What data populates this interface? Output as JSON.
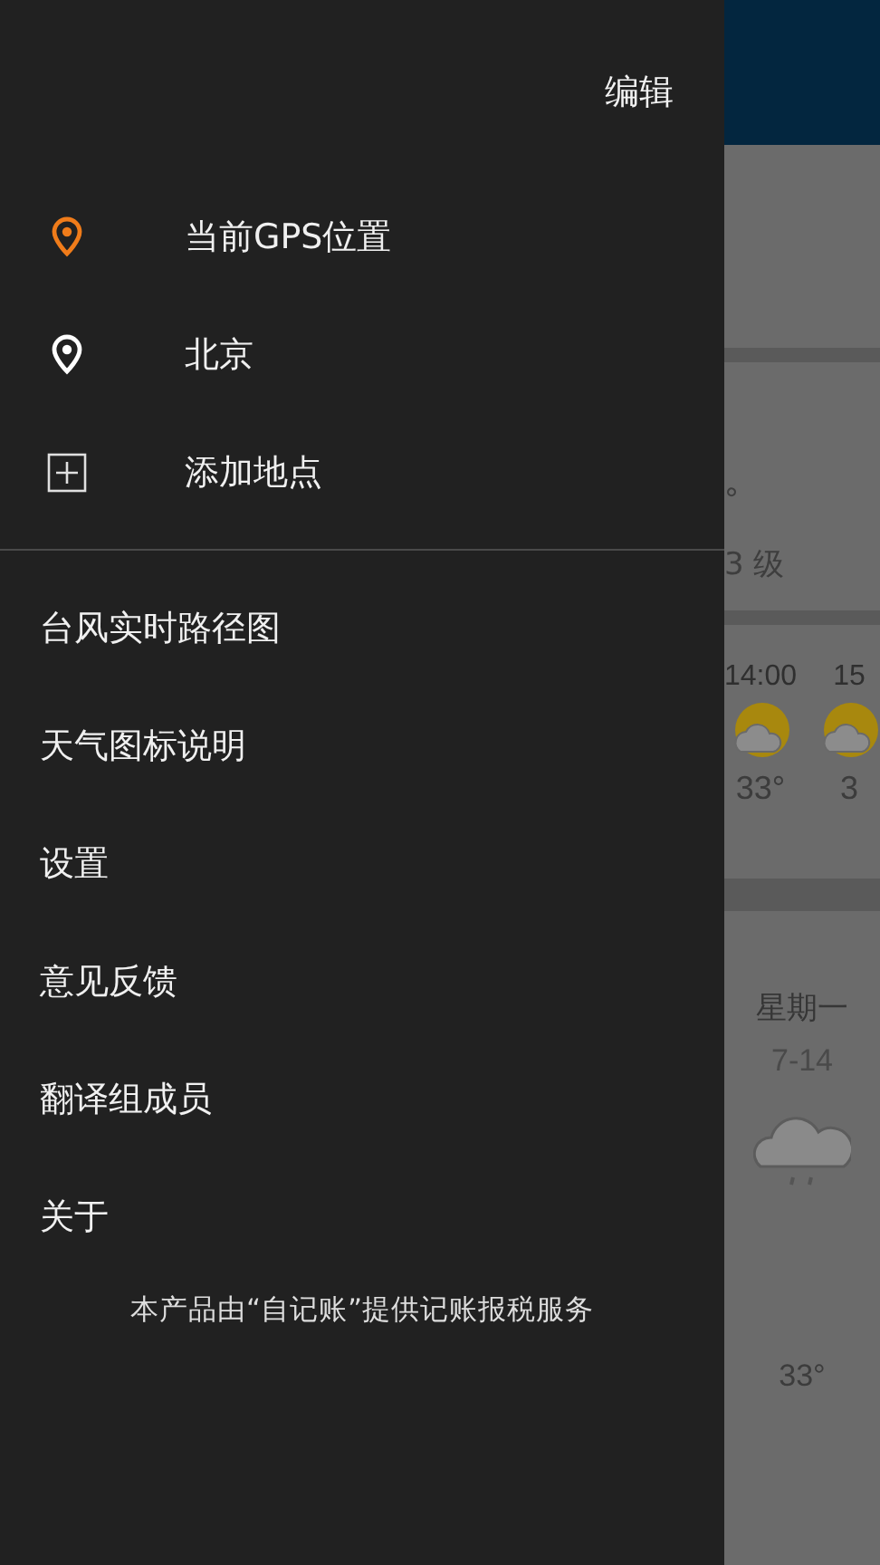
{
  "drawer": {
    "edit_label": "编辑",
    "locations": [
      {
        "kind": "gps",
        "label": "当前GPS位置"
      },
      {
        "kind": "city",
        "label": "北京"
      },
      {
        "kind": "add",
        "label": "添加地点"
      }
    ],
    "menu": [
      "台风实时路径图",
      "天气图标说明",
      "设置",
      "意见反馈",
      "翻译组成员",
      "关于"
    ],
    "footer": "本产品由“自记账”提供记账报税服务"
  },
  "background": {
    "current": {
      "temp_unit": "°",
      "wind": "3 级"
    },
    "hourly": [
      {
        "time": "14:00",
        "temp": "33°"
      },
      {
        "time": "15",
        "temp": "3"
      }
    ],
    "daily": {
      "day": "星期一",
      "date": "7-14",
      "temp": "33°"
    }
  }
}
